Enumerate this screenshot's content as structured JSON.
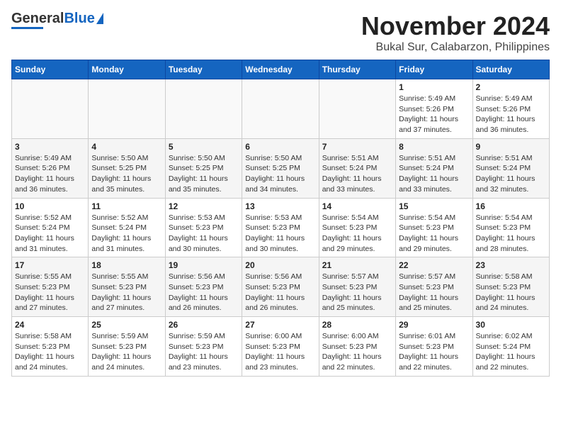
{
  "header": {
    "logo": {
      "general": "General",
      "blue": "Blue",
      "tagline": ""
    },
    "month": "November 2024",
    "location": "Bukal Sur, Calabarzon, Philippines"
  },
  "days_of_week": [
    "Sunday",
    "Monday",
    "Tuesday",
    "Wednesday",
    "Thursday",
    "Friday",
    "Saturday"
  ],
  "weeks": [
    [
      {
        "day": "",
        "info": ""
      },
      {
        "day": "",
        "info": ""
      },
      {
        "day": "",
        "info": ""
      },
      {
        "day": "",
        "info": ""
      },
      {
        "day": "",
        "info": ""
      },
      {
        "day": "1",
        "info": "Sunrise: 5:49 AM\nSunset: 5:26 PM\nDaylight: 11 hours\nand 37 minutes."
      },
      {
        "day": "2",
        "info": "Sunrise: 5:49 AM\nSunset: 5:26 PM\nDaylight: 11 hours\nand 36 minutes."
      }
    ],
    [
      {
        "day": "3",
        "info": "Sunrise: 5:49 AM\nSunset: 5:26 PM\nDaylight: 11 hours\nand 36 minutes."
      },
      {
        "day": "4",
        "info": "Sunrise: 5:50 AM\nSunset: 5:25 PM\nDaylight: 11 hours\nand 35 minutes."
      },
      {
        "day": "5",
        "info": "Sunrise: 5:50 AM\nSunset: 5:25 PM\nDaylight: 11 hours\nand 35 minutes."
      },
      {
        "day": "6",
        "info": "Sunrise: 5:50 AM\nSunset: 5:25 PM\nDaylight: 11 hours\nand 34 minutes."
      },
      {
        "day": "7",
        "info": "Sunrise: 5:51 AM\nSunset: 5:24 PM\nDaylight: 11 hours\nand 33 minutes."
      },
      {
        "day": "8",
        "info": "Sunrise: 5:51 AM\nSunset: 5:24 PM\nDaylight: 11 hours\nand 33 minutes."
      },
      {
        "day": "9",
        "info": "Sunrise: 5:51 AM\nSunset: 5:24 PM\nDaylight: 11 hours\nand 32 minutes."
      }
    ],
    [
      {
        "day": "10",
        "info": "Sunrise: 5:52 AM\nSunset: 5:24 PM\nDaylight: 11 hours\nand 31 minutes."
      },
      {
        "day": "11",
        "info": "Sunrise: 5:52 AM\nSunset: 5:24 PM\nDaylight: 11 hours\nand 31 minutes."
      },
      {
        "day": "12",
        "info": "Sunrise: 5:53 AM\nSunset: 5:23 PM\nDaylight: 11 hours\nand 30 minutes."
      },
      {
        "day": "13",
        "info": "Sunrise: 5:53 AM\nSunset: 5:23 PM\nDaylight: 11 hours\nand 30 minutes."
      },
      {
        "day": "14",
        "info": "Sunrise: 5:54 AM\nSunset: 5:23 PM\nDaylight: 11 hours\nand 29 minutes."
      },
      {
        "day": "15",
        "info": "Sunrise: 5:54 AM\nSunset: 5:23 PM\nDaylight: 11 hours\nand 29 minutes."
      },
      {
        "day": "16",
        "info": "Sunrise: 5:54 AM\nSunset: 5:23 PM\nDaylight: 11 hours\nand 28 minutes."
      }
    ],
    [
      {
        "day": "17",
        "info": "Sunrise: 5:55 AM\nSunset: 5:23 PM\nDaylight: 11 hours\nand 27 minutes."
      },
      {
        "day": "18",
        "info": "Sunrise: 5:55 AM\nSunset: 5:23 PM\nDaylight: 11 hours\nand 27 minutes."
      },
      {
        "day": "19",
        "info": "Sunrise: 5:56 AM\nSunset: 5:23 PM\nDaylight: 11 hours\nand 26 minutes."
      },
      {
        "day": "20",
        "info": "Sunrise: 5:56 AM\nSunset: 5:23 PM\nDaylight: 11 hours\nand 26 minutes."
      },
      {
        "day": "21",
        "info": "Sunrise: 5:57 AM\nSunset: 5:23 PM\nDaylight: 11 hours\nand 25 minutes."
      },
      {
        "day": "22",
        "info": "Sunrise: 5:57 AM\nSunset: 5:23 PM\nDaylight: 11 hours\nand 25 minutes."
      },
      {
        "day": "23",
        "info": "Sunrise: 5:58 AM\nSunset: 5:23 PM\nDaylight: 11 hours\nand 24 minutes."
      }
    ],
    [
      {
        "day": "24",
        "info": "Sunrise: 5:58 AM\nSunset: 5:23 PM\nDaylight: 11 hours\nand 24 minutes."
      },
      {
        "day": "25",
        "info": "Sunrise: 5:59 AM\nSunset: 5:23 PM\nDaylight: 11 hours\nand 24 minutes."
      },
      {
        "day": "26",
        "info": "Sunrise: 5:59 AM\nSunset: 5:23 PM\nDaylight: 11 hours\nand 23 minutes."
      },
      {
        "day": "27",
        "info": "Sunrise: 6:00 AM\nSunset: 5:23 PM\nDaylight: 11 hours\nand 23 minutes."
      },
      {
        "day": "28",
        "info": "Sunrise: 6:00 AM\nSunset: 5:23 PM\nDaylight: 11 hours\nand 22 minutes."
      },
      {
        "day": "29",
        "info": "Sunrise: 6:01 AM\nSunset: 5:23 PM\nDaylight: 11 hours\nand 22 minutes."
      },
      {
        "day": "30",
        "info": "Sunrise: 6:02 AM\nSunset: 5:24 PM\nDaylight: 11 hours\nand 22 minutes."
      }
    ]
  ]
}
